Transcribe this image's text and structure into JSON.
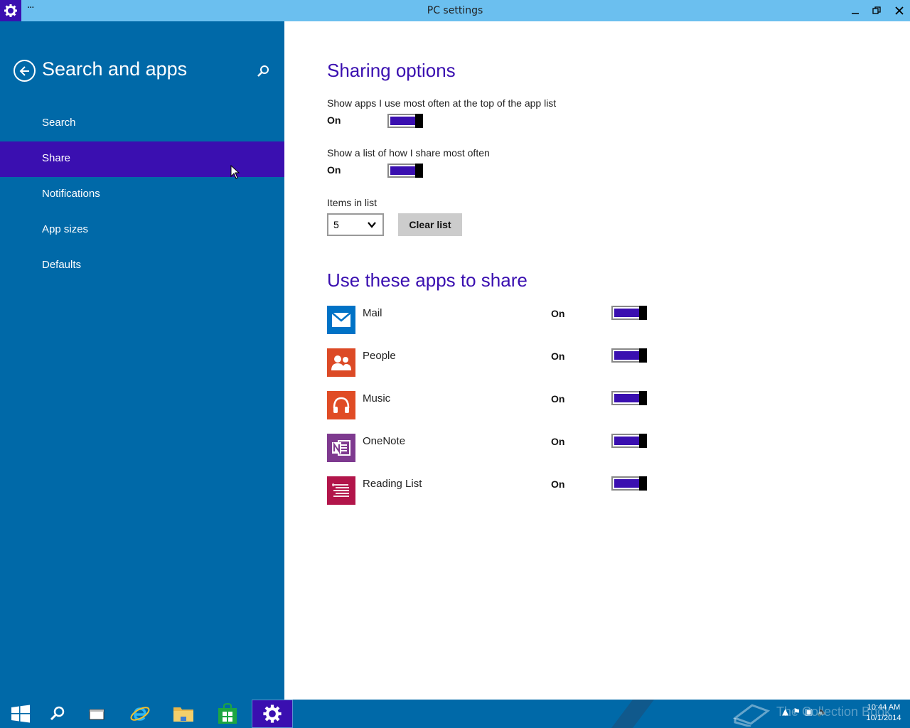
{
  "window": {
    "title": "PC settings",
    "menu_dots": "···",
    "minimize_icon": "minimize-icon",
    "maximize_icon": "restore-icon",
    "close_icon": "close-icon"
  },
  "left_pane": {
    "title": "Search and apps",
    "back_icon": "back-arrow-icon",
    "search_icon": "search-icon",
    "items": [
      {
        "label": "Search",
        "selected": false
      },
      {
        "label": "Share",
        "selected": true
      },
      {
        "label": "Notifications",
        "selected": false
      },
      {
        "label": "App sizes",
        "selected": false
      },
      {
        "label": "Defaults",
        "selected": false
      }
    ]
  },
  "sharing_options": {
    "heading": "Sharing options",
    "setting1": {
      "label": "Show apps I use most often at the top of the app list",
      "state": "On"
    },
    "setting2": {
      "label": "Show a list of how I share most often",
      "state": "On"
    },
    "items_in_list": {
      "label": "Items in list",
      "value": "5"
    },
    "clear_button": "Clear list"
  },
  "apps_section": {
    "heading": "Use these apps to share",
    "apps": [
      {
        "name": "Mail",
        "state": "On",
        "color": "#0072c6",
        "icon": "mail-icon"
      },
      {
        "name": "People",
        "state": "On",
        "color": "#dc4a26",
        "icon": "people-icon"
      },
      {
        "name": "Music",
        "state": "On",
        "color": "#e04c25",
        "icon": "headphones-icon"
      },
      {
        "name": "OneNote",
        "state": "On",
        "color": "#7e3a8f",
        "icon": "onenote-icon"
      },
      {
        "name": "Reading List",
        "state": "On",
        "color": "#b2154a",
        "icon": "reading-list-icon"
      }
    ]
  },
  "taskbar": {
    "items": [
      "start-icon",
      "search-icon",
      "task-view-icon",
      "internet-explorer-icon",
      "file-explorer-icon",
      "store-icon",
      "settings-icon"
    ],
    "clock_time": "10:44 AM",
    "clock_date": "10/1/2014",
    "watermark": "The Collection Book"
  },
  "colors": {
    "accent": "#3a0fb0",
    "pane": "#0069a8",
    "titlebar": "#6bbfef"
  }
}
